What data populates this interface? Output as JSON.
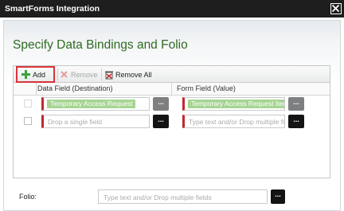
{
  "window": {
    "title": "SmartForms Integration",
    "close_icon": "close-x-icon"
  },
  "heading": "Specify Data Bindings and Folio",
  "toolbar": {
    "add_label": "Add",
    "remove_label": "Remove",
    "remove_all_label": "Remove All"
  },
  "columns": {
    "data_field": "Data Field (Destination)",
    "form_field": "Form Field (Value)"
  },
  "rows": [
    {
      "data_field_chip": "Temporary Access Request",
      "form_field_chip": "Temporary Access Request Item",
      "dots": "..."
    },
    {
      "data_field_placeholder": "Drop a single field",
      "form_field_placeholder": "Type text and/or Drop multiple fields",
      "dots": "..."
    }
  ],
  "folio": {
    "label": "Folio:",
    "placeholder": "Type text and/or Drop multiple fields",
    "dots": "..."
  },
  "colors": {
    "heading": "#2f6a23",
    "chip": "#a6d592",
    "required_marker": "#c0282e",
    "highlight_border": "#d9343a"
  }
}
